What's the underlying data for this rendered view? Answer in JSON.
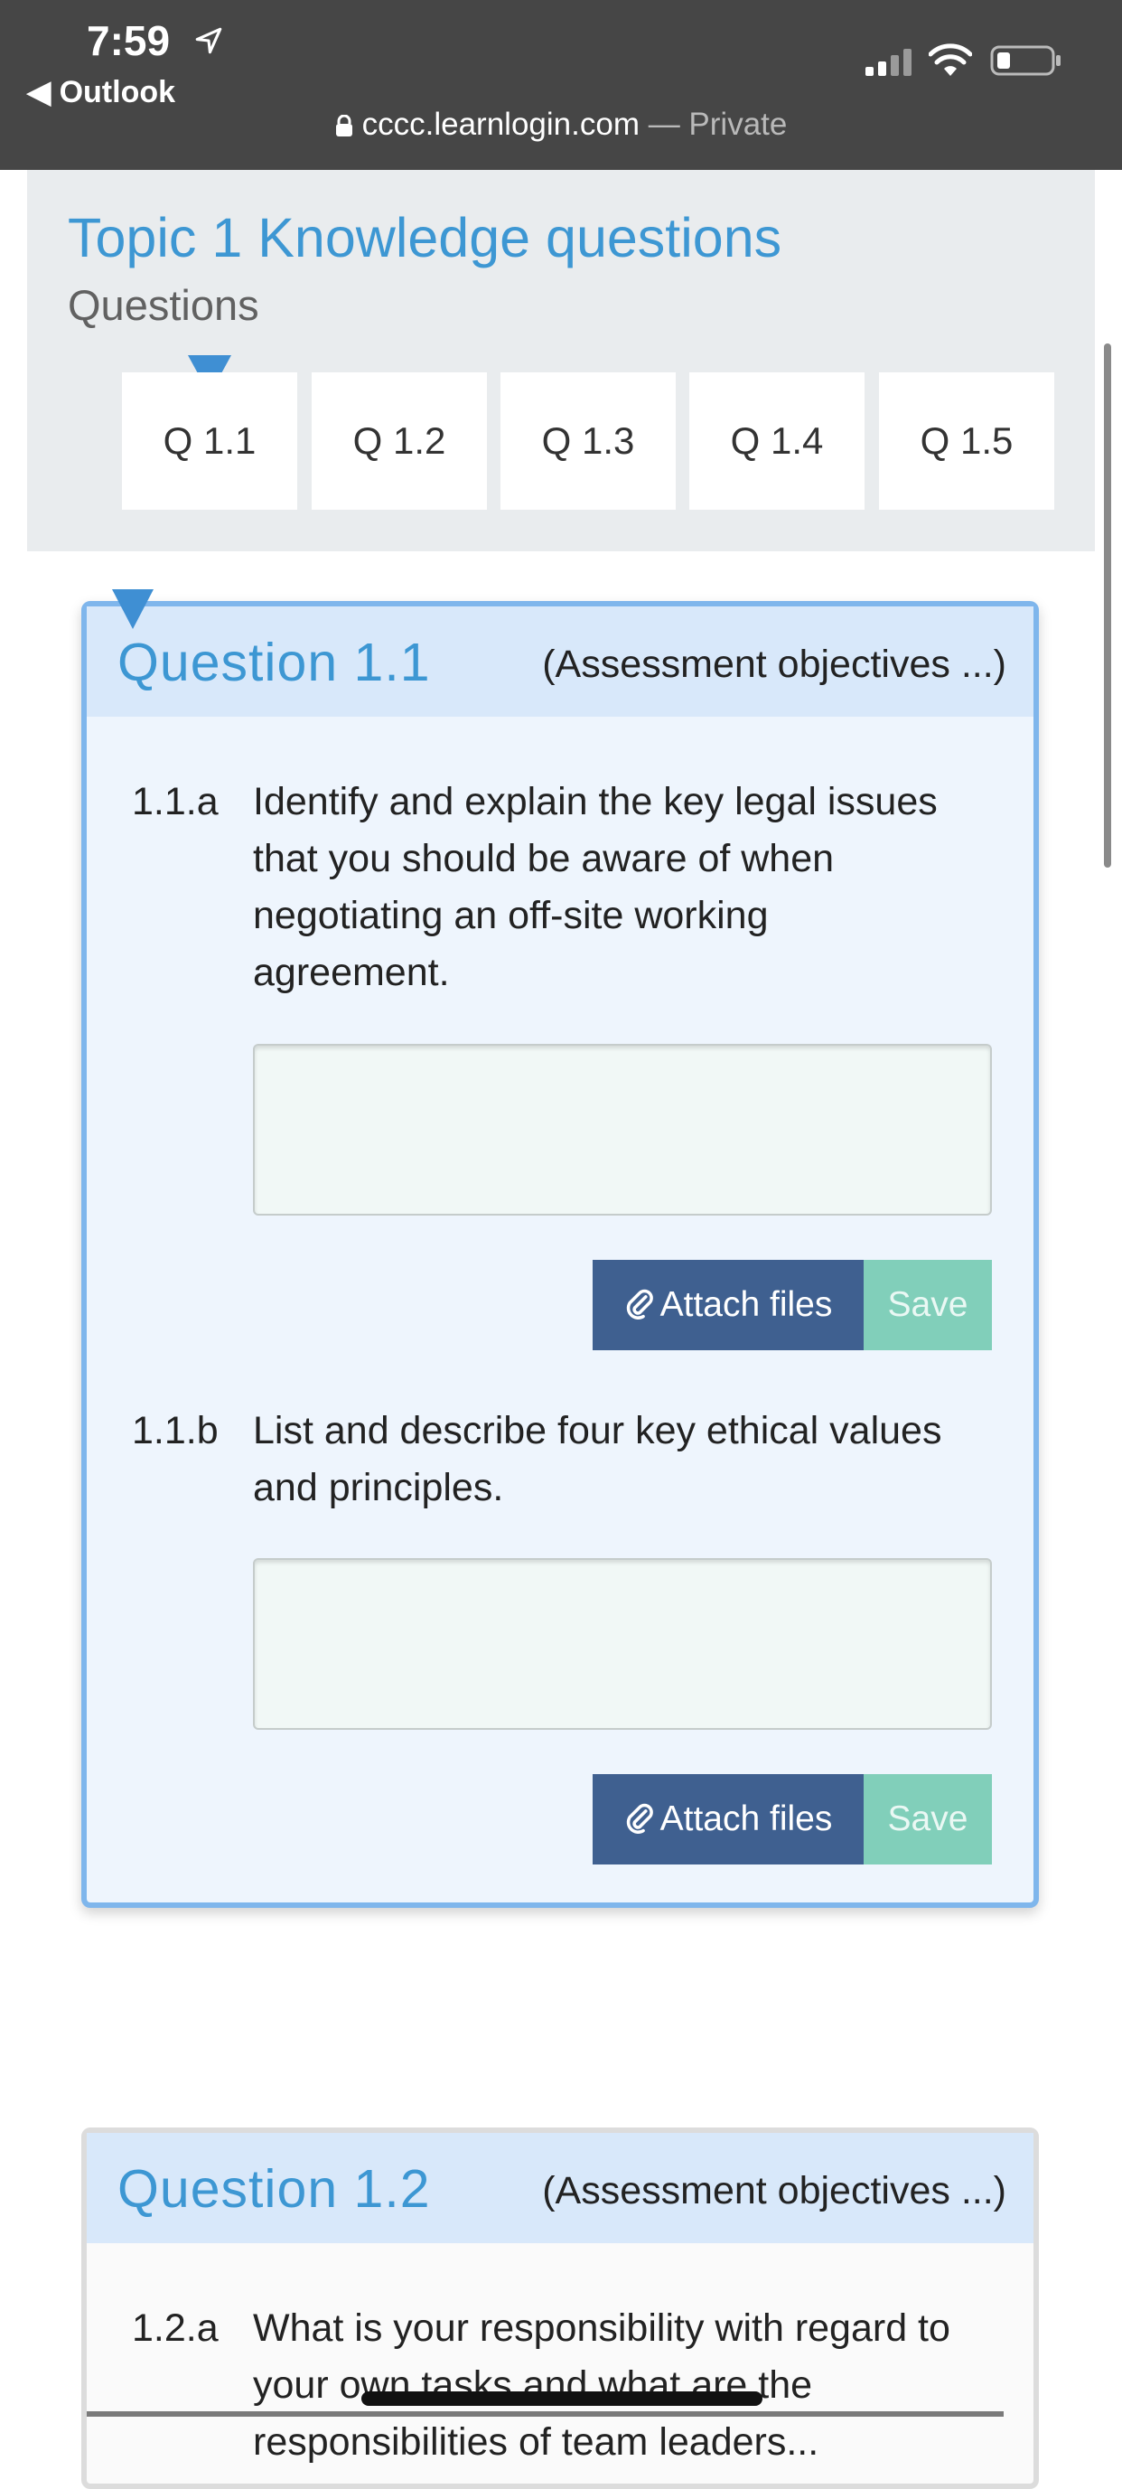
{
  "status_bar": {
    "time": "7:59",
    "back_app": "◀ Outlook",
    "url_domain": "cccc.learnlogin.com",
    "url_private": " — Private",
    "icons": [
      "location-arrow-icon",
      "signal-icon",
      "wifi-icon",
      "battery-icon",
      "lock-icon"
    ]
  },
  "topic": {
    "title": "Topic 1 Knowledge questions",
    "subtitle": "Questions",
    "tabs": [
      "Q 1.1",
      "Q 1.2",
      "Q 1.3",
      "Q 1.4",
      "Q 1.5"
    ],
    "active_tab": "Q 1.1"
  },
  "question1": {
    "title": "Question 1.1",
    "objectives": "(Assessment objectives ...)",
    "parts": [
      {
        "num": "1.1.a",
        "lines": [
          "Identify and explain the key legal issues",
          "that you should be aware of when",
          "negotiating an off-site working",
          "agreement."
        ],
        "answer_value": "",
        "attach_label": "Attach files",
        "save_label": "Save"
      },
      {
        "num": "1.1.b",
        "lines": [
          "List and describe four key ethical values",
          "and principles."
        ],
        "answer_value": "",
        "attach_label": "Attach files",
        "save_label": "Save"
      }
    ]
  },
  "question2": {
    "title": "Question 1.2",
    "objectives": "(Assessment objectives ...)",
    "parts": [
      {
        "num": "1.2.a",
        "lines": [
          "What is your responsibility with regard to",
          "your own tasks and what are the",
          "responsibilities of team leaders..."
        ]
      }
    ]
  },
  "colors": {
    "status_bar_bg": "#464646",
    "accent_blue": "#3d97d3",
    "attach_button": "#3f6090",
    "save_button": "#81cfba",
    "card_border_active": "#7fb6ec"
  }
}
